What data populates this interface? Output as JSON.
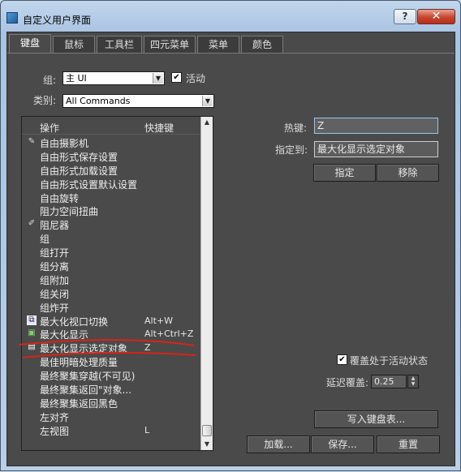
{
  "window": {
    "title": "自定义用户界面",
    "help_label": "?",
    "close_label": "✕"
  },
  "tabs": [
    "键盘",
    "鼠标",
    "工具栏",
    "四元菜单",
    "菜单",
    "颜色"
  ],
  "group": {
    "label": "组:",
    "value": "主 UI",
    "active_checkbox_label": "活动",
    "active_checked": true
  },
  "category": {
    "label": "类别:",
    "value": "All Commands"
  },
  "list": {
    "header_action": "操作",
    "header_shortcut": "快捷键",
    "rows": [
      {
        "name": "自由摄影机",
        "key": "",
        "icon": "camera-icon"
      },
      {
        "name": "自由形式保存设置",
        "key": "",
        "icon": ""
      },
      {
        "name": "自由形式加载设置",
        "key": "",
        "icon": ""
      },
      {
        "name": "自由形式设置默认设置",
        "key": "",
        "icon": ""
      },
      {
        "name": "自由旋转",
        "key": "",
        "icon": ""
      },
      {
        "name": "阻力空间扭曲",
        "key": "",
        "icon": ""
      },
      {
        "name": "阻尼器",
        "key": "",
        "icon": "damper-icon"
      },
      {
        "name": "组",
        "key": "",
        "icon": ""
      },
      {
        "name": "组打开",
        "key": "",
        "icon": ""
      },
      {
        "name": "组分离",
        "key": "",
        "icon": ""
      },
      {
        "name": "组附加",
        "key": "",
        "icon": ""
      },
      {
        "name": "组关闭",
        "key": "",
        "icon": ""
      },
      {
        "name": "组炸开",
        "key": "",
        "icon": ""
      },
      {
        "name": "最大化视口切换",
        "key": "Alt+W",
        "icon": "maximize-viewport-icon"
      },
      {
        "name": "最大化显示",
        "key": "Alt+Ctrl+Z",
        "icon": "zoom-extents-icon"
      },
      {
        "name": "最大化显示选定对象",
        "key": "Z",
        "icon": "zoom-extents-selected-icon"
      },
      {
        "name": "最佳明暗处理质量",
        "key": "",
        "icon": ""
      },
      {
        "name": "最终聚集穿越(不可见)",
        "key": "",
        "icon": ""
      },
      {
        "name": "最终聚集返回\"对象...",
        "key": "",
        "icon": ""
      },
      {
        "name": "最终聚集返回黑色",
        "key": "",
        "icon": ""
      },
      {
        "name": "左对齐",
        "key": "",
        "icon": ""
      },
      {
        "name": "左视图",
        "key": "L",
        "icon": ""
      }
    ]
  },
  "hotkey": {
    "label": "热键:",
    "value": "Z",
    "assigned_label": "指定到:",
    "assigned_value": "最大化显示选定对象",
    "assign_button": "指定",
    "remove_button": "移除"
  },
  "override": {
    "checkbox_label": "覆盖处于活动状态",
    "checked": true,
    "delay_label": "延迟覆盖:",
    "delay_value": "0.25"
  },
  "buttons": {
    "write_keyboard_chart": "写入键盘表...",
    "load": "加载...",
    "save": "保存...",
    "reset": "重置"
  },
  "colors": {
    "annotation_red": "#d8231c",
    "panel_bg": "#4a4a4a"
  }
}
